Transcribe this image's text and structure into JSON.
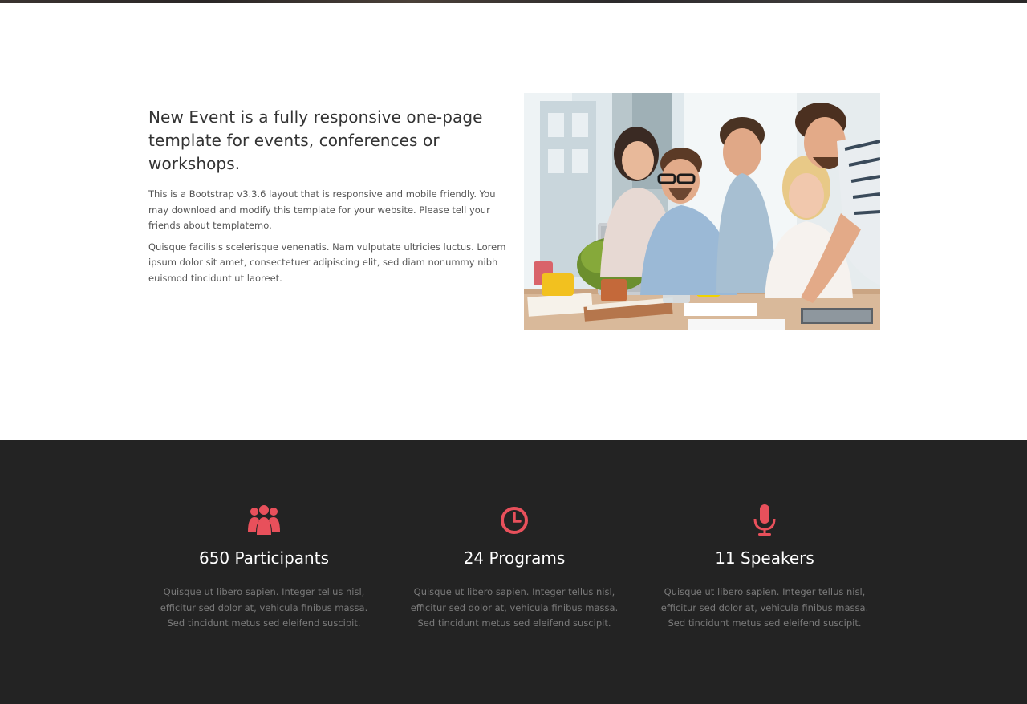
{
  "intro": {
    "title": "New Event is a fully responsive one-page template for events, conferences or workshops.",
    "paragraph_1": "This is a Bootstrap v3.3.6 layout that is responsive and mobile friendly. You may download and modify this template for your website. Please tell your friends about templatemo.",
    "paragraph_2": "Quisque facilisis scelerisque venenatis. Nam vulputate ultricies luctus. Lorem ipsum dolor sit amet, consectetuer adipiscing elit, sed diam nonummy nibh euismod tincidunt ut laoreet."
  },
  "stats": {
    "accent_color": "#e8505b",
    "items": [
      {
        "icon": "users-icon",
        "title": "650 Participants",
        "description": "Quisque ut libero sapien. Integer tellus nisl, efficitur sed dolor at, vehicula finibus massa. Sed tincidunt metus sed eleifend suscipit."
      },
      {
        "icon": "clock-icon",
        "title": "24 Programs",
        "description": "Quisque ut libero sapien. Integer tellus nisl, efficitur sed dolor at, vehicula finibus massa. Sed tincidunt metus sed eleifend suscipit."
      },
      {
        "icon": "microphone-icon",
        "title": "11 Speakers",
        "description": "Quisque ut libero sapien. Integer tellus nisl, efficitur sed dolor at, vehicula finibus massa. Sed tincidunt metus sed eleifend suscipit."
      }
    ]
  }
}
